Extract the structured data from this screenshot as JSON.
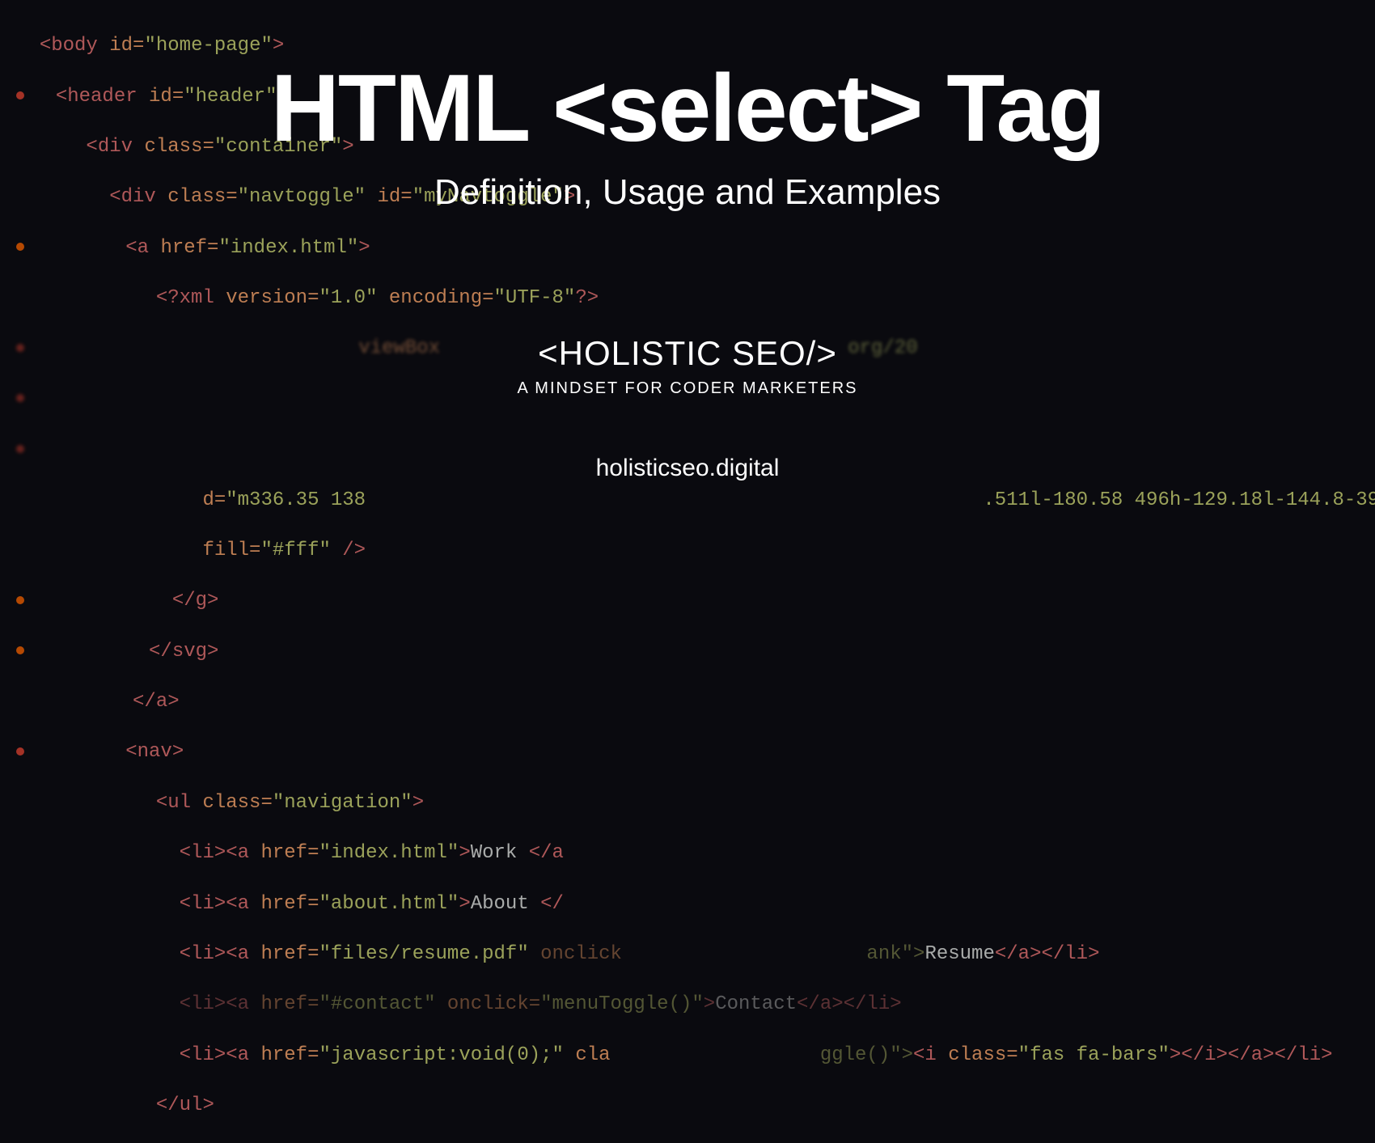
{
  "overlay": {
    "title": "HTML <select> Tag",
    "subtitle": "Definition, Usage and Examples",
    "brand": "<HOLISTIC SEO/>",
    "tagline": "A MINDSET FOR CODER  MARKETERS",
    "url": "holisticseo.digital"
  },
  "code": {
    "l1": {
      "tag_open": "<body ",
      "attr1": "id=",
      "val1": "\"home-page\"",
      "tag_close": ">"
    },
    "l2": {
      "tag_open": "<header ",
      "attr1": "id=",
      "val1": "\"header\"",
      "tag_close": ">"
    },
    "l3": {
      "tag_open": "<div ",
      "attr1": "class=",
      "val1": "\"container\"",
      "tag_close": ">"
    },
    "l4": {
      "tag_open": "<div ",
      "attr1": "class=",
      "val1": "\"navtoggle\" ",
      "attr2": "id=",
      "val2": "\"myNavtoggle\"",
      "tag_close": ">"
    },
    "l5": {
      "tag_open": "<a ",
      "attr1": "href=",
      "val1": "\"index.html\"",
      "tag_close": ">"
    },
    "l6": {
      "tag_open": "<?xml ",
      "attr1": "version=",
      "val1": "\"1.0\" ",
      "attr2": "encoding=",
      "val2": "\"UTF-8\"",
      "tag_close": "?>"
    },
    "l7": {
      "text": "viewBox"
    },
    "l8": {
      "text": "org/20"
    },
    "l9": {
      "attr1": "d=",
      "val1": "\"m336.35 138 ",
      "trail": ".511l-180.58 496h-129.18l-144.8-39"
    },
    "l10": {
      "attr1": "fill=",
      "val1": "\"#fff\"",
      "tag_close": " />"
    },
    "l11": {
      "tag": "</g>"
    },
    "l12": {
      "tag": "</svg>"
    },
    "l13": {
      "tag": "</a>"
    },
    "l14": {
      "tag": "<nav>"
    },
    "l15": {
      "tag_open": "<ul ",
      "attr1": "class=",
      "val1": "\"navigation\"",
      "tag_close": ">"
    },
    "l16": {
      "li_open": "<li>",
      "a_open": "<a ",
      "attr1": "href=",
      "val1": "\"index.html\"",
      "close": ">",
      "text": "Work ",
      "a_close": "</a"
    },
    "l17": {
      "li_open": "<li>",
      "a_open": "<a ",
      "attr1": "href=",
      "val1": "\"about.html\"",
      "close": ">",
      "text": "About ",
      "a_close": "</"
    },
    "l18": {
      "li_open": "<li>",
      "a_open": "<a ",
      "attr1": "href=",
      "val1": "\"files/resume.pdf\" ",
      "attr2": "onclick",
      "rest": "ank\">",
      "text": "Resume",
      "a_close": "</a>",
      "li_close": "</li>"
    },
    "l19": {
      "li_open": "<li>",
      "a_open": "<a ",
      "attr1": "href=",
      "val1": "\"#contact\" ",
      "attr2": "onclick=",
      "val2": "\"menuToggle()\"",
      "close": ">",
      "text": "Contact",
      "a_close": "</a>",
      "li_close": "</li>"
    },
    "l20": {
      "li_open": "<li>",
      "a_open": "<a ",
      "attr1": "href=",
      "val1": "\"javascript:void(0);\" ",
      "attr2": "cla",
      "rest": "ggle()\">",
      "i_open": "<i ",
      "i_attr": "class=",
      "i_val": "\"fas fa-bars\"",
      "i_close": "></i>",
      "a_close": "</a>",
      "li_close": "</li>"
    },
    "l21": {
      "tag": "</ul>"
    }
  }
}
